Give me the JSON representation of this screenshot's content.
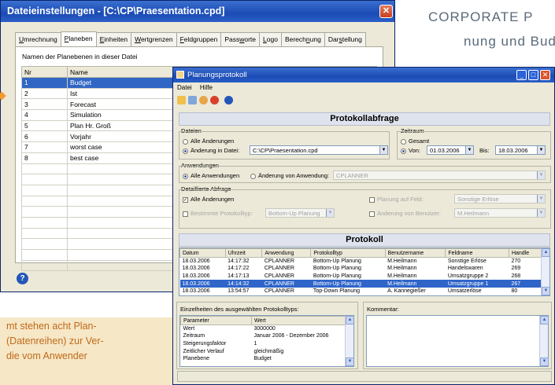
{
  "page": {
    "corporate_line1": "CORPORATE P",
    "corporate_line2": "nung und Bud",
    "caption_lines": [
      "mt stehen acht Plan-",
      "(Datenreihen) zur Ver-",
      " die vom Anwender"
    ],
    "accent_color": "#f29a2e"
  },
  "win1": {
    "title": "Dateieinstellungen - [C:\\CP\\Praesentation.cpd]",
    "close_icon": "close-icon",
    "tabs": [
      {
        "pre": "",
        "acc": "U",
        "post": "mrechnung"
      },
      {
        "pre": "",
        "acc": "P",
        "post": "laneben"
      },
      {
        "pre": "",
        "acc": "E",
        "post": "inheiten"
      },
      {
        "pre": "",
        "acc": "W",
        "post": "ertgrenzen"
      },
      {
        "pre": "",
        "acc": "F",
        "post": "eldgruppen"
      },
      {
        "pre": "Pass",
        "acc": "w",
        "post": "orte"
      },
      {
        "pre": "",
        "acc": "L",
        "post": "ogo"
      },
      {
        "pre": "Berech",
        "acc": "n",
        "post": "ung"
      },
      {
        "pre": "Dar",
        "acc": "s",
        "post": "tellung"
      }
    ],
    "grid_label": "Namen der Planebenen in dieser Datei",
    "columns": [
      "Nr",
      "Name"
    ],
    "rows": [
      [
        "1",
        "Budget"
      ],
      [
        "2",
        "Ist"
      ],
      [
        "3",
        "Forecast"
      ],
      [
        "4",
        "Simulation"
      ],
      [
        "5",
        "Plan Hr. Groß"
      ],
      [
        "6",
        "Vorjahr"
      ],
      [
        "7",
        "worst case"
      ],
      [
        "8",
        "best case"
      ],
      [
        "",
        ""
      ],
      [
        "",
        ""
      ],
      [
        "",
        ""
      ],
      [
        "",
        ""
      ],
      [
        "",
        ""
      ],
      [
        "",
        ""
      ],
      [
        "",
        ""
      ],
      [
        "",
        ""
      ],
      [
        "",
        ""
      ],
      [
        "",
        ""
      ]
    ],
    "help_icon": "help-icon"
  },
  "win2": {
    "title": "Planungsprotokoll",
    "menu": [
      "Datei",
      "Hilfe"
    ],
    "query_header": "Protokollabfrage",
    "files_label": "Dateien",
    "all_changes": "Alle Änderungen",
    "change_in_file": "Änderung in Datei:",
    "file_value": "C:\\CP\\Praesentation.cpd",
    "period_label": "Zeitraum",
    "total": "Gesamt",
    "from": "Von:",
    "from_value": "01.03.2006",
    "to": "Bis:",
    "to_value": "18.03.2006",
    "applications_label": "Anwendungen",
    "all_applications": "Alle Anwendungen",
    "change_by_app": "Änderung von Anwendung:",
    "app_value": "CPLANNER",
    "detailed_label": "Detaillierte Abfrage",
    "all_changes_chk": "Alle Änderungen",
    "certain_types": "Bestimmte Protokolltyp:",
    "type_value": "Bottom-Up Planung",
    "planning_field": "Planung auf Feld:",
    "field_value": "Sonstige Erlöse",
    "change_by_user": "Änderung von Benutzer:",
    "user_value": "M.Heilmann",
    "protocol_header": "Protokoll",
    "log_columns": [
      "Datum",
      "Uhrzeit",
      "Anwendung",
      "Protokolltyp",
      "Benutzername",
      "Feldname",
      "Handle"
    ],
    "log_rows": [
      [
        "18.03.2006",
        "14:17:32",
        "CPLANNER",
        "Bottom-Up Planung",
        "M.Heilmann",
        "Sonstige Erlöse",
        "270"
      ],
      [
        "18.03.2006",
        "14:17:22",
        "CPLANNER",
        "Bottom-Up Planung",
        "M.Heilmann",
        "Handelswaren",
        "269"
      ],
      [
        "18.03.2006",
        "14:17:13",
        "CPLANNER",
        "Bottom-Up Planung",
        "M.Heilmann",
        "Umsatzgruppe 2",
        "268"
      ],
      [
        "18.03.2006",
        "14:14:32",
        "CPLANNER",
        "Bottom-Up Planung",
        "M.Heilmann",
        "Umsatzgruppe 1",
        "267"
      ],
      [
        "18.03.2006",
        "13:54:57",
        "CPLANNER",
        "Top-Down Planung",
        "A. Kannegießer",
        "Umsatzerlöse",
        "80"
      ]
    ],
    "details_label": "Einzelheiten des ausgewählten Protokolltyps:",
    "param_columns": [
      "Parameter",
      "Wert"
    ],
    "params": [
      [
        "Wert",
        "3000000"
      ],
      [
        "Zeitraum",
        "Januar 2006 - Dezember 2006"
      ],
      [
        "Steigerungsfaktor",
        "1"
      ],
      [
        "Zeitlicher Verlauf",
        "gleichmäßig"
      ],
      [
        "Planebene",
        "Budget"
      ]
    ],
    "comment_label": "Kommentar:"
  }
}
